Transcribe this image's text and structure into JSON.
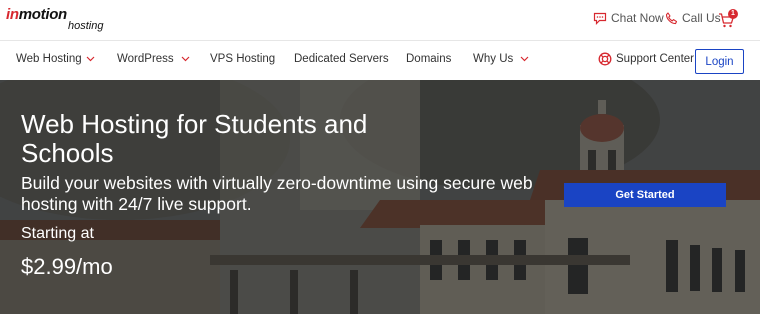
{
  "brand": {
    "logo_text_left": "in",
    "logo_text_right": "motion",
    "logo_sub": "hosting"
  },
  "utility": {
    "chat_label": "Chat Now",
    "call_label": "Call Us",
    "cart_count": "1"
  },
  "nav": {
    "items": [
      {
        "label": "Web Hosting",
        "dropdown": true
      },
      {
        "label": "WordPress",
        "dropdown": true
      },
      {
        "label": "VPS Hosting",
        "dropdown": false
      },
      {
        "label": "Dedicated Servers",
        "dropdown": false
      },
      {
        "label": "Domains",
        "dropdown": false
      },
      {
        "label": "Why Us",
        "dropdown": true
      }
    ],
    "support_label": "Support Center",
    "login_label": "Login"
  },
  "hero": {
    "title": "Web Hosting for Students and Schools",
    "subtitle": "Build your websites with virtually zero-downtime using secure web hosting with 24/7 live support.",
    "starting_label": "Starting at",
    "price": "$2.99/mo",
    "cta_label": "Get Started"
  },
  "colors": {
    "accent_red": "#d7282f",
    "primary_blue": "#1a44c4"
  }
}
